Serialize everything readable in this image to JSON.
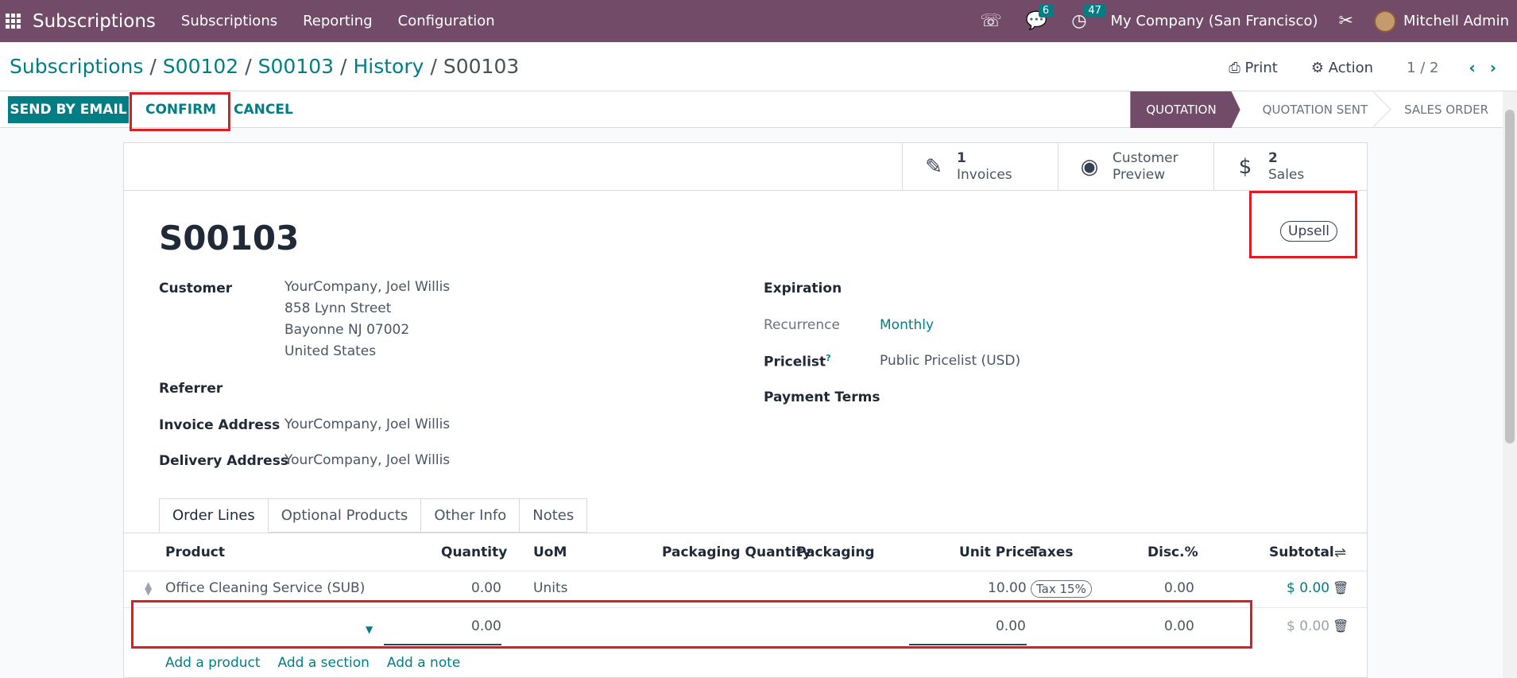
{
  "navbar": {
    "brand": "Subscriptions",
    "menus": [
      "Subscriptions",
      "Reporting",
      "Configuration"
    ],
    "messages_count": "6",
    "activities_count": "47",
    "company": "My Company (San Francisco)",
    "user": "Mitchell Admin",
    "accent": "#714b67"
  },
  "breadcrumb": {
    "items": [
      "Subscriptions",
      "S00102",
      "S00103",
      "History"
    ],
    "current": "S00103",
    "separator": "/"
  },
  "crumb_actions": {
    "print": "Print",
    "action": "Action",
    "pager": "1 / 2"
  },
  "statusbar": {
    "send_email": "SEND BY EMAIL",
    "confirm": "CONFIRM",
    "cancel": "CANCEL",
    "stages": [
      "QUOTATION",
      "QUOTATION SENT",
      "SALES ORDER"
    ],
    "active_stage": "QUOTATION"
  },
  "smart_buttons": {
    "invoices_count": "1",
    "invoices_label": "Invoices",
    "preview_line1": "Customer",
    "preview_line2": "Preview",
    "sales_count": "2",
    "sales_label": "Sales"
  },
  "record": {
    "title": "S00103",
    "ribbon": "Upsell"
  },
  "form": {
    "customer_label": "Customer",
    "customer_lines": [
      "YourCompany, Joel Willis",
      "858 Lynn Street",
      "Bayonne NJ 07002",
      "United States"
    ],
    "referrer_label": "Referrer",
    "invoice_address_label": "Invoice Address",
    "invoice_address": "YourCompany, Joel Willis",
    "delivery_address_label": "Delivery Address",
    "delivery_address": "YourCompany, Joel Willis",
    "expiration_label": "Expiration",
    "recurrence_label": "Recurrence",
    "recurrence": "Monthly",
    "pricelist_label": "Pricelist",
    "pricelist_help": "?",
    "pricelist": "Public Pricelist (USD)",
    "payment_terms_label": "Payment Terms"
  },
  "tabs": [
    "Order Lines",
    "Optional Products",
    "Other Info",
    "Notes"
  ],
  "order_lines": {
    "columns": {
      "product": "Product",
      "quantity": "Quantity",
      "uom": "UoM",
      "packaging_qty": "Packaging Quantity",
      "packaging": "Packaging",
      "unit_price": "Unit Price",
      "taxes": "Taxes",
      "discount": "Disc.%",
      "subtotal": "Subtotal"
    },
    "rows": [
      {
        "product": "Office Cleaning Service (SUB)",
        "quantity": "0.00",
        "uom": "Units",
        "unit_price": "10.00",
        "tax": "Tax 15%",
        "discount": "0.00",
        "subtotal": "$ 0.00"
      }
    ],
    "editing_row": {
      "quantity": "0.00",
      "unit_price": "0.00",
      "discount": "0.00",
      "subtotal": "$ 0.00"
    },
    "add_links": [
      "Add a product",
      "Add a section",
      "Add a note"
    ]
  }
}
